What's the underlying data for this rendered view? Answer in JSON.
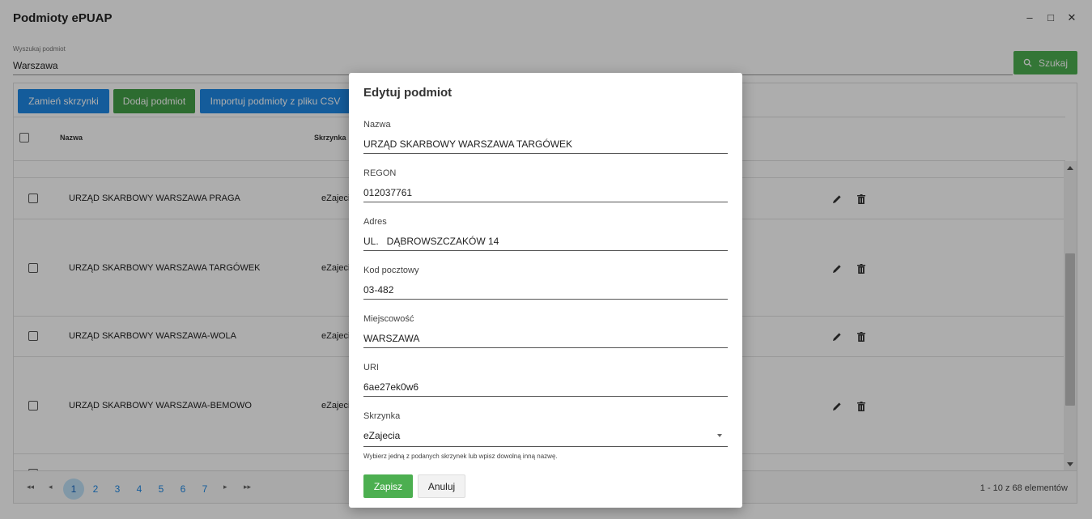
{
  "window": {
    "title": "Podmioty ePUAP",
    "controls": {
      "minimize": "–",
      "maximize": "□",
      "close": "✕"
    }
  },
  "search": {
    "label": "Wyszukaj podmiot",
    "value": "Warszawa",
    "button_label": "Szukaj"
  },
  "toolbar": {
    "swap_label": "Zamień skrzynki",
    "add_label": "Dodaj podmiot",
    "import_label": "Importuj podmioty z pliku CSV"
  },
  "grid": {
    "columns": [
      "Nazwa",
      "Skrzynka"
    ],
    "rows": [
      {
        "name": "URZĄD SKARBOWY WARSZAWA PRAGA",
        "box": "eZajeci"
      },
      {
        "name": "URZĄD SKARBOWY WARSZAWA TARGÓWEK",
        "box": "eZajeci"
      },
      {
        "name": "URZĄD SKARBOWY WARSZAWA-WOLA",
        "box": "eZajeci"
      },
      {
        "name": "URZĄD SKARBOWY WARSZAWA-BEMOWO",
        "box": "eZajeci"
      }
    ],
    "scroll_position": 0.5
  },
  "pager": {
    "first": "◂◂",
    "prev": "◂",
    "next": "▸",
    "last": "▸▸",
    "pages": [
      "1",
      "2",
      "3",
      "4",
      "5",
      "6",
      "7"
    ],
    "active_page": "1",
    "info": "1 - 10 z 68 elementów"
  },
  "dialog": {
    "title": "Edytuj podmiot",
    "fields": [
      {
        "label": "Nazwa",
        "value": "URZĄD SKARBOWY WARSZAWA TARGÓWEK"
      },
      {
        "label": "REGON",
        "value": "012037761"
      },
      {
        "label": "Adres",
        "value": "UL.   DĄBROWSZCZAKÓW 14"
      },
      {
        "label": "Kod pocztowy",
        "value": "03-482"
      },
      {
        "label": "Miejscowość",
        "value": "WARSZAWA"
      },
      {
        "label": "URI",
        "value": "6ae27ek0w6"
      }
    ],
    "mailbox": {
      "label": "Skrzynka",
      "value": "eZajecia",
      "hint": "Wybierz jedną z podanych skrzynek lub wpisz dowolną inną nazwę."
    },
    "save_label": "Zapisz",
    "cancel_label": "Anuluj"
  },
  "colors": {
    "primary_blue": "#1e88e5",
    "success_green": "#4caf50",
    "overlay": "rgba(0,0,0,0.32)"
  }
}
